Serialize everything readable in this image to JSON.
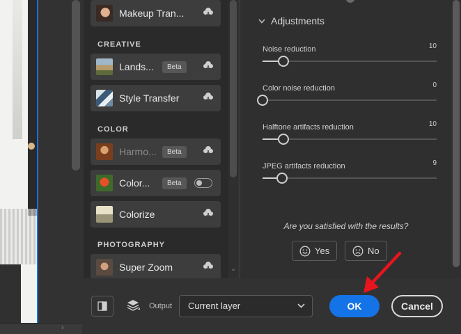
{
  "filters": {
    "items": [
      {
        "label": "Makeup Tran...",
        "beta": "",
        "action": "cloud-download-icon"
      },
      {
        "label": "Lands...",
        "beta": "Beta",
        "action": "cloud-download-icon"
      },
      {
        "label": "Style Transfer",
        "beta": "",
        "action": "cloud-download-icon"
      },
      {
        "label": "Harmo...",
        "beta": "Beta",
        "action": "cloud-download-icon"
      },
      {
        "label": "Color...",
        "beta": "Beta",
        "action": "toggle"
      },
      {
        "label": "Colorize",
        "beta": "",
        "action": "cloud-download-icon"
      },
      {
        "label": "Super Zoom",
        "beta": "",
        "action": "cloud-download-icon"
      }
    ],
    "sections": {
      "creative": "CREATIVE",
      "color": "COLOR",
      "photography": "PHOTOGRAPHY"
    }
  },
  "adjustments": {
    "title": "Adjustments",
    "sliders": [
      {
        "name": "Noise reduction",
        "value": "10",
        "level": 0.12
      },
      {
        "name": "Color noise reduction",
        "value": "0",
        "level": 0.0
      },
      {
        "name": "Halftone artifacts reduction",
        "value": "10",
        "level": 0.12
      },
      {
        "name": "JPEG artifacts reduction",
        "value": "9",
        "level": 0.11
      }
    ],
    "question": "Are you satisfied with the results?",
    "yes_label": "Yes",
    "no_label": "No"
  },
  "footer": {
    "output_label": "Output",
    "output_value": "Current layer",
    "ok_label": "OK",
    "cancel_label": "Cancel"
  },
  "colors": {
    "accent": "#1473e6",
    "annotation_arrow": "#e8141e"
  }
}
